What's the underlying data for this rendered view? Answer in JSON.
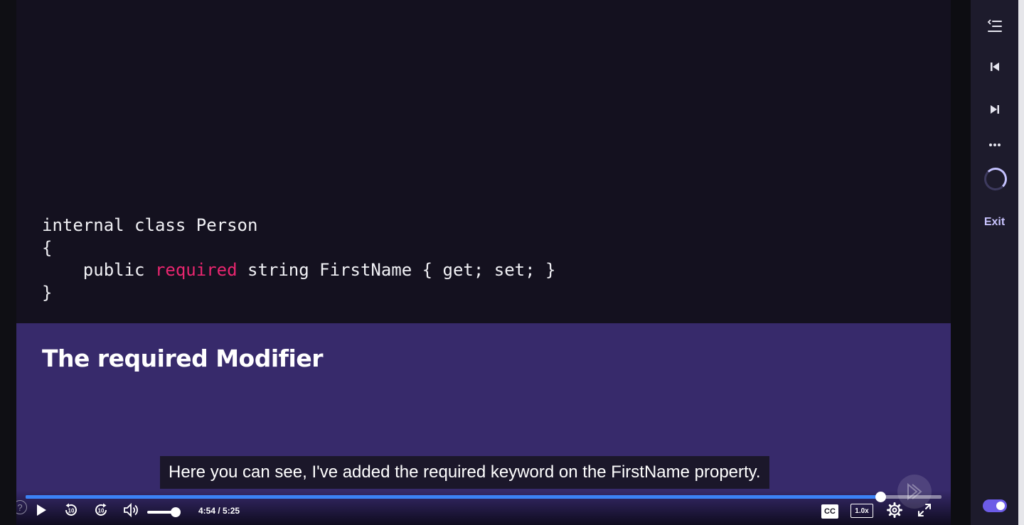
{
  "slide": {
    "code_lines": [
      {
        "pre": "internal class Person",
        "kw": "",
        "post": ""
      },
      {
        "pre": "{",
        "kw": "",
        "post": ""
      },
      {
        "pre": "    public ",
        "kw": "required",
        "post": " string FirstName { get; set; }"
      },
      {
        "pre": "}",
        "kw": "",
        "post": ""
      }
    ],
    "title": "The required Modifier"
  },
  "caption": {
    "text": "Here you can see, I've added the required keyword on the FirstName property."
  },
  "player": {
    "progress": 0.933,
    "volume": 1.0,
    "time_label": "4:54 / 5:25",
    "cc_label": "CC",
    "speed_label": "1.0x",
    "help_label": "?",
    "icons": [
      "play-icon",
      "rewind-10-icon",
      "forward-10-icon",
      "volume-icon",
      "settings-icon",
      "fullscreen-icon"
    ]
  },
  "sidebar": {
    "icons": [
      "playlist-icon",
      "previous-track-icon",
      "next-track-icon",
      "more-icon",
      "progress-spinner-icon"
    ],
    "exit_label": "Exit",
    "toggle_on": true
  },
  "colors": {
    "background": "#14111f",
    "slide_panel": "#372a6b",
    "keyword": "#e8266f",
    "progress": "#3b82f6",
    "toggle": "#6c5ce7",
    "exit": "#c9c4ff"
  }
}
